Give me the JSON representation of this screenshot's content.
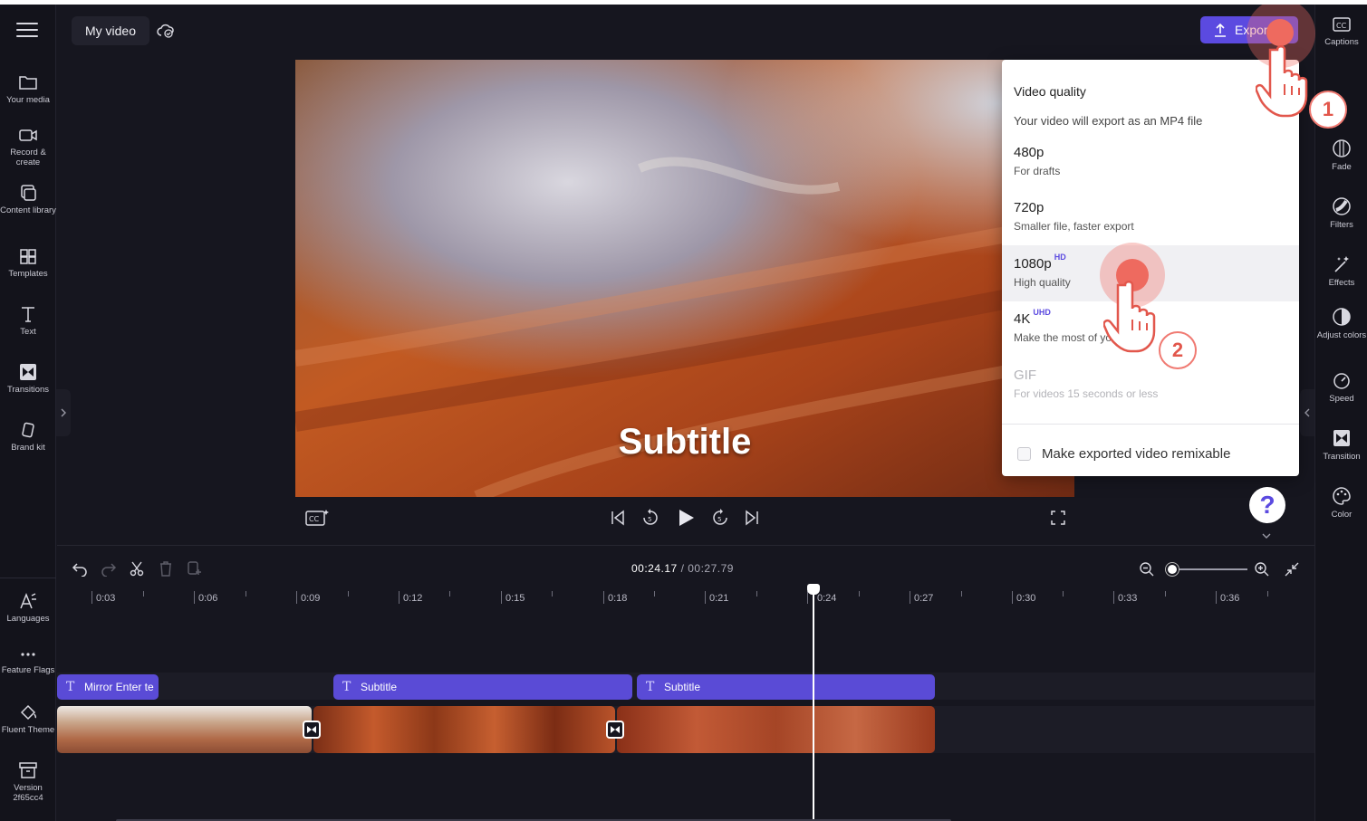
{
  "app": {
    "project_name": "My video",
    "export_label": "Export"
  },
  "left_sidebar": {
    "items": [
      {
        "label": "Your media",
        "icon": "folder-icon"
      },
      {
        "label": "Record & create",
        "icon": "camera-icon"
      },
      {
        "label": "Content library",
        "icon": "library-icon"
      },
      {
        "label": "Templates",
        "icon": "templates-icon"
      },
      {
        "label": "Text",
        "icon": "text-icon"
      },
      {
        "label": "Transitions",
        "icon": "transitions-icon"
      },
      {
        "label": "Brand kit",
        "icon": "brand-kit-icon"
      }
    ],
    "bottom_items": [
      {
        "label": "Languages",
        "icon": "languages-icon"
      },
      {
        "label": "Feature Flags",
        "icon": "more-icon"
      },
      {
        "label": "Fluent Theme",
        "icon": "paint-bucket-icon"
      },
      {
        "label": "Version 2f65cc4",
        "icon": "archive-icon"
      }
    ]
  },
  "right_sidebar": {
    "items": [
      {
        "label": "Captions",
        "icon": "captions-icon"
      },
      {
        "label": "Fade",
        "icon": "fade-icon"
      },
      {
        "label": "Filters",
        "icon": "filters-icon"
      },
      {
        "label": "Effects",
        "icon": "effects-icon"
      },
      {
        "label": "Adjust colors",
        "icon": "adjust-colors-icon"
      },
      {
        "label": "Speed",
        "icon": "speed-icon"
      },
      {
        "label": "Transition",
        "icon": "transition-icon"
      },
      {
        "label": "Color",
        "icon": "color-icon"
      }
    ]
  },
  "preview": {
    "subtitle": "Subtitle"
  },
  "export_menu": {
    "title": "Video quality",
    "subtitle": "Your video will export as an MP4 file",
    "options": [
      {
        "label": "480p",
        "badge": "",
        "desc": "For drafts",
        "disabled": false
      },
      {
        "label": "720p",
        "badge": "",
        "desc": "Smaller file, faster export",
        "disabled": false
      },
      {
        "label": "1080p",
        "badge": "HD",
        "desc": "High quality",
        "disabled": false
      },
      {
        "label": "4K",
        "badge": "UHD",
        "desc": "Make the most of yo",
        "disabled": false
      },
      {
        "label": "GIF",
        "badge": "",
        "desc": "For videos 15 seconds or less",
        "disabled": true
      }
    ],
    "remix_label": "Make exported video remixable"
  },
  "tutorial": {
    "step1": "1",
    "step2": "2"
  },
  "help": {
    "label": "?"
  },
  "timeline": {
    "current_time": "00:24.17",
    "total_time": "/ 00:27.79",
    "ticks": [
      "0:03",
      "0:06",
      "0:09",
      "0:12",
      "0:15",
      "0:18",
      "0:21",
      "0:24",
      "0:27",
      "0:30",
      "0:33",
      "0:36"
    ],
    "text_clips": [
      "Mirror Enter te",
      "Subtitle",
      "Subtitle"
    ]
  },
  "colors": {
    "accent": "#5b4ae0",
    "background": "#16161f",
    "tutorial_red": "#f07a72"
  }
}
